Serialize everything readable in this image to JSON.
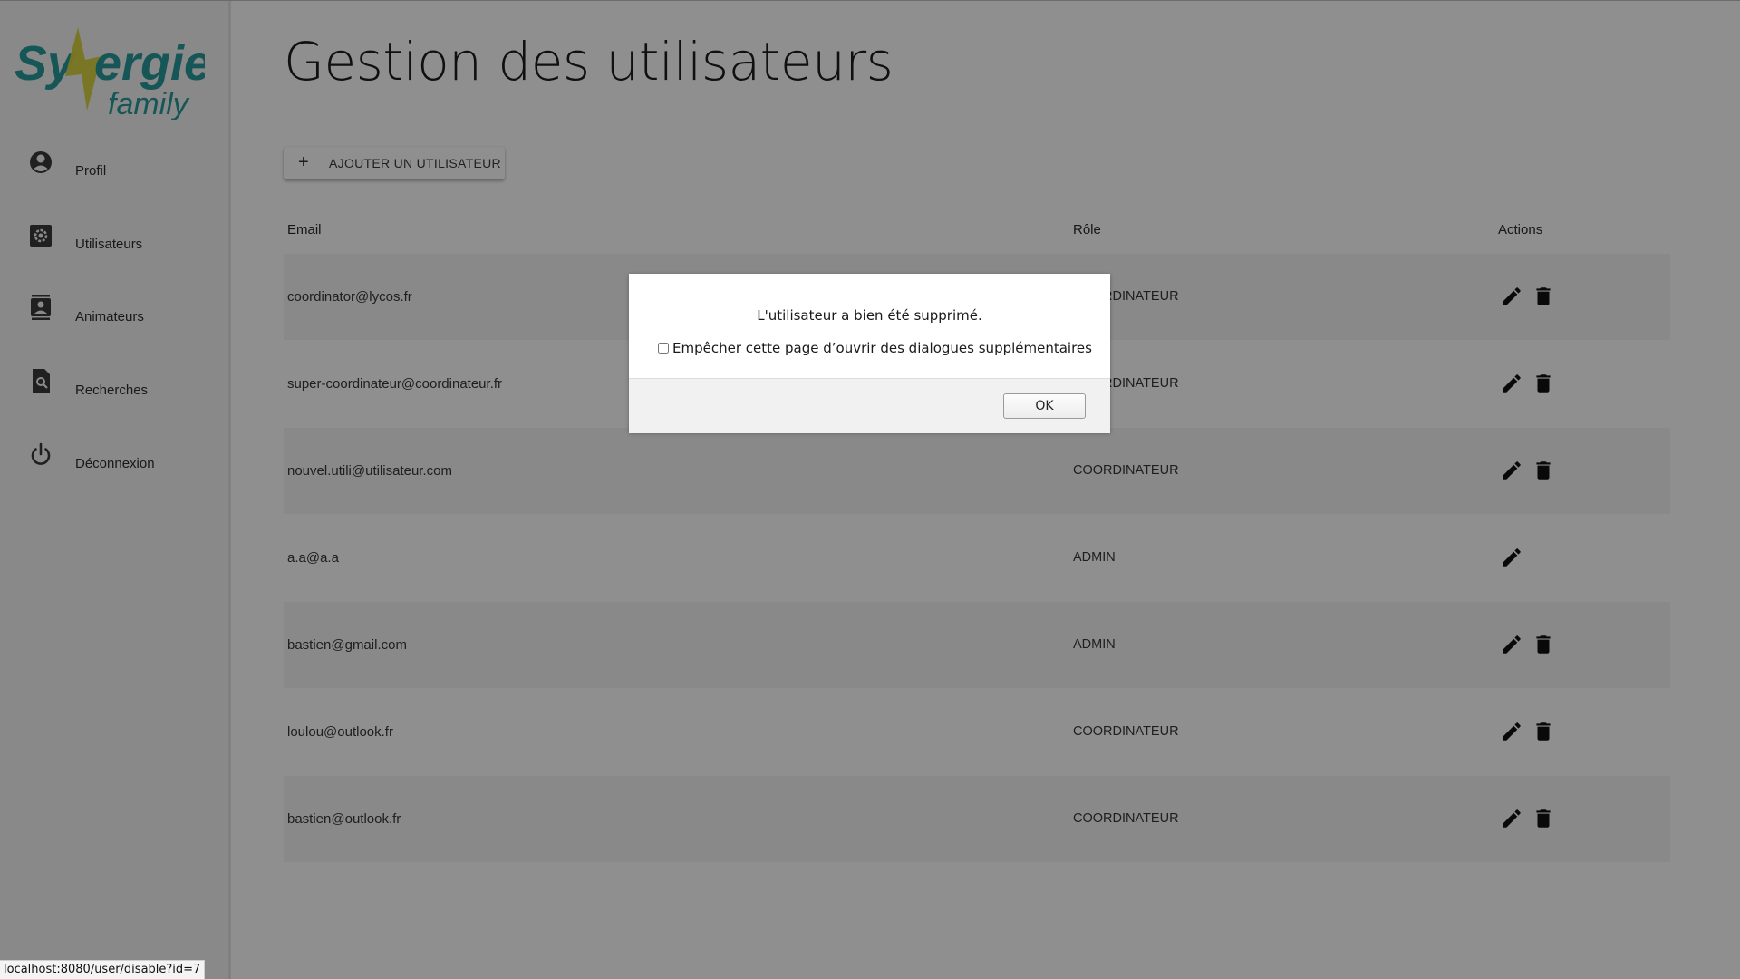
{
  "brand": {
    "logo_line1": "Synergie",
    "logo_line2": "family"
  },
  "sidebar": {
    "items": [
      {
        "label": "Profil",
        "icon": "account-circle-icon"
      },
      {
        "label": "Utilisateurs",
        "icon": "settings-box-icon"
      },
      {
        "label": "Animateurs",
        "icon": "contacts-icon"
      },
      {
        "label": "Recherches",
        "icon": "search-document-icon"
      },
      {
        "label": "Déconnexion",
        "icon": "power-icon"
      }
    ]
  },
  "page": {
    "title": "Gestion des utilisateurs",
    "add_button": {
      "icon_text": "+",
      "label": "AJOUTER UN UTILISATEUR"
    }
  },
  "table": {
    "headers": {
      "email": "Email",
      "role": "Rôle",
      "actions": "Actions"
    },
    "rows": [
      {
        "email": "coordinator@lycos.fr",
        "role": "COORDINATEUR",
        "deletable": true
      },
      {
        "email": "super-coordinateur@coordinateur.fr",
        "role": "COORDINATEUR",
        "deletable": true
      },
      {
        "email": "nouvel.utili@utilisateur.com",
        "role": "COORDINATEUR",
        "deletable": true
      },
      {
        "email": "a.a@a.a",
        "role": "ADMIN",
        "deletable": false
      },
      {
        "email": "bastien@gmail.com",
        "role": "ADMIN",
        "deletable": true
      },
      {
        "email": "loulou@outlook.fr",
        "role": "COORDINATEUR",
        "deletable": true
      },
      {
        "email": "bastien@outlook.fr",
        "role": "COORDINATEUR",
        "deletable": true
      }
    ]
  },
  "dialog": {
    "message": "L'utilisateur a bien été supprimé.",
    "checkbox_label": "Empêcher cette page d’ouvrir des dialogues supplémentaires",
    "ok_label": "OK"
  },
  "status_bar": {
    "url": "localhost:8080/user/disable?id=7"
  },
  "colors": {
    "logo_teal": "#2a9a9c",
    "logo_bolt": "#d6d23b",
    "overlay": "rgba(0,0,0,0.44)",
    "sidebar_bg": "#f5f5f5",
    "row_shade": "#f4f4f4"
  }
}
